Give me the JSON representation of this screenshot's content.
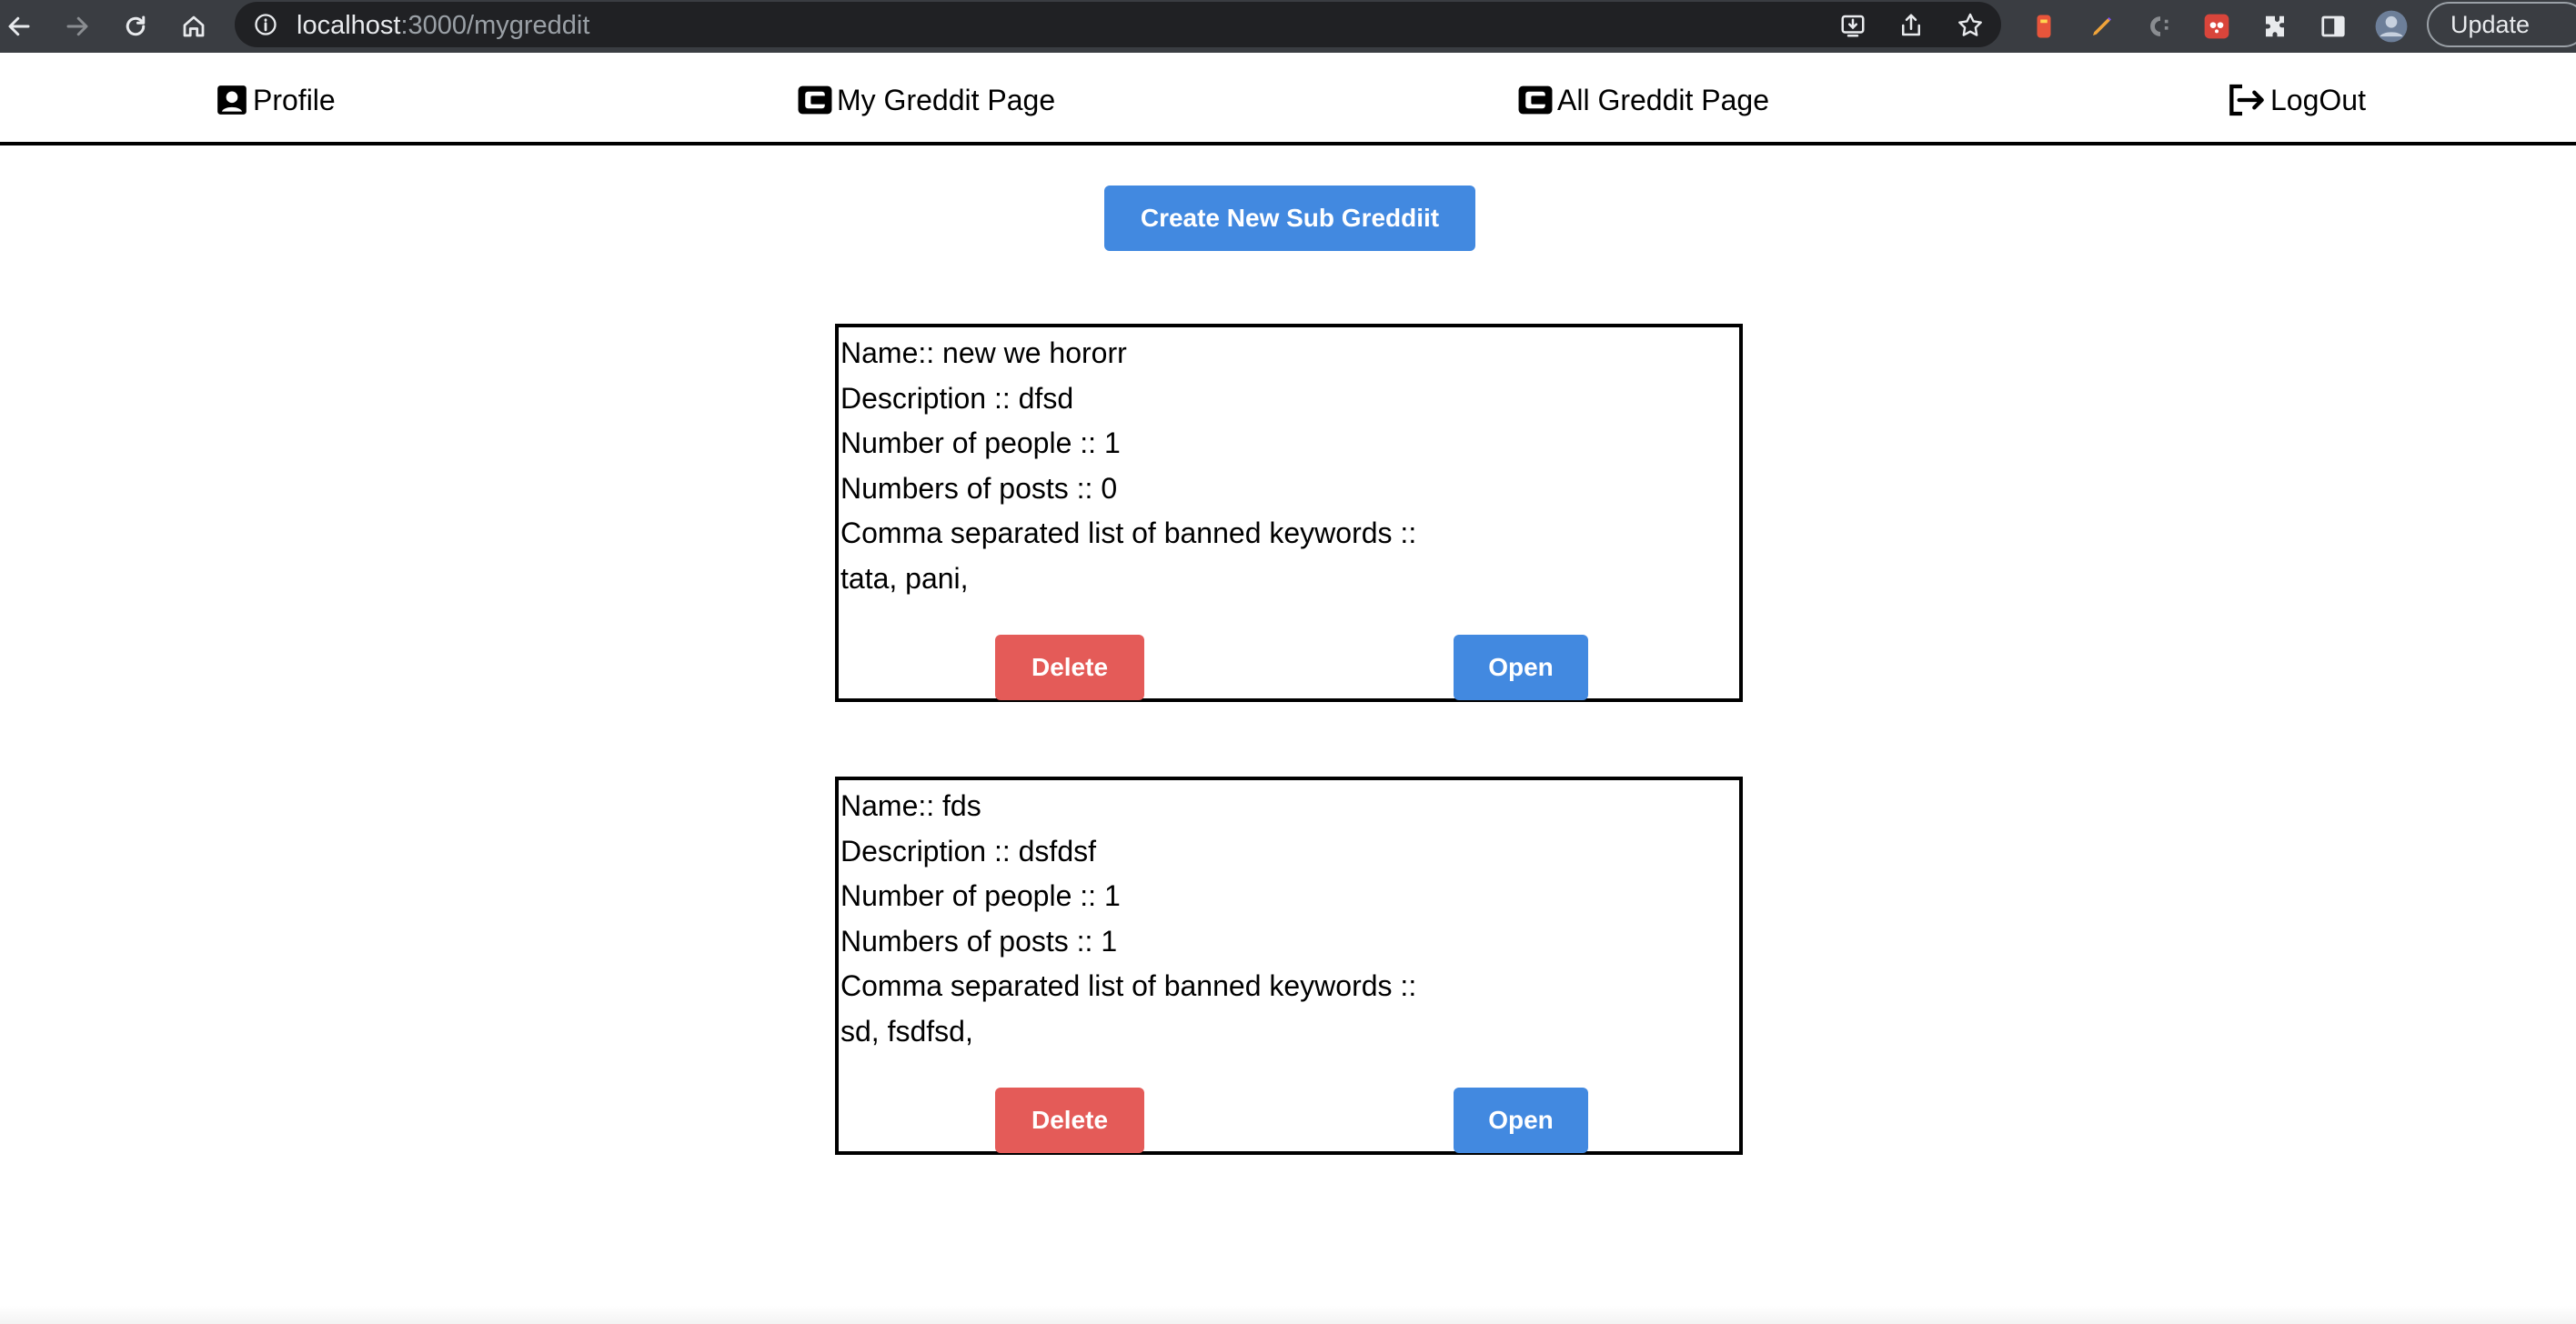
{
  "browser": {
    "url_host": "localhost",
    "url_rest": ":3000/mygreddit",
    "update_label": "Update"
  },
  "nav": {
    "profile": "Profile",
    "my_page": "My Greddit Page",
    "all_page": "All Greddit Page",
    "logout": "LogOut"
  },
  "create_button": "Create New Sub Greddiit",
  "subgreddits": [
    {
      "name": "Name:: new we hororr",
      "description": "Description :: dfsd",
      "people": "Number of people :: 1",
      "posts": "Numbers of posts :: 0",
      "banned_label": "Comma separated list of banned keywords ::",
      "banned": "tata, pani,",
      "delete": "Delete",
      "open": "Open"
    },
    {
      "name": "Name:: fds",
      "description": "Description :: dsfdsf",
      "people": "Number of people :: 1",
      "posts": "Numbers of posts :: 1",
      "banned_label": "Comma separated list of banned keywords ::",
      "banned": "sd, fsdfsd,",
      "delete": "Delete",
      "open": "Open"
    }
  ],
  "colors": {
    "primary": "#4289e0",
    "danger": "#e45b58",
    "chrome": "#3a3d42"
  }
}
